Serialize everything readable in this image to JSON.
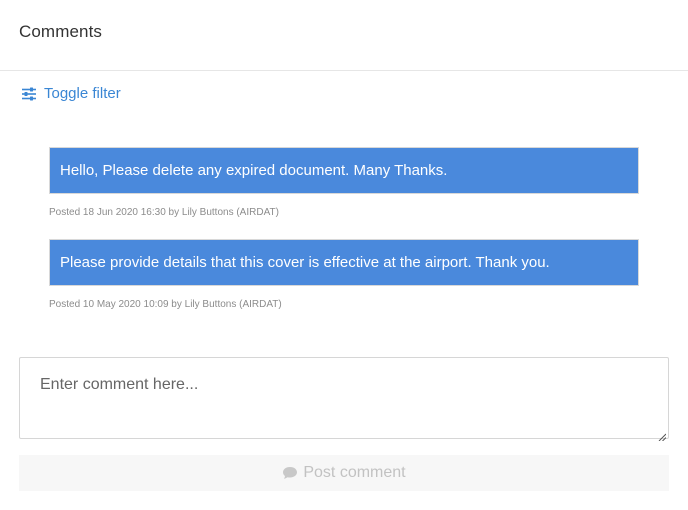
{
  "header": {
    "title": "Comments"
  },
  "filter": {
    "label": "Toggle filter",
    "icon": "sliders-icon"
  },
  "comments": [
    {
      "text": "Hello, Please delete any expired document. Many Thanks.",
      "meta": "Posted 18 Jun 2020 16:30 by Lily Buttons (AIRDAT)"
    },
    {
      "text": "Please provide details that this cover is effective at the airport. Thank you.",
      "meta": "Posted 10 May 2020 10:09 by Lily Buttons (AIRDAT)"
    }
  ],
  "composer": {
    "placeholder": "Enter comment here...",
    "value": "",
    "post_label": "Post comment",
    "post_icon": "comment-icon"
  },
  "colors": {
    "accent": "#4a89dc",
    "link": "#3a86d4"
  }
}
